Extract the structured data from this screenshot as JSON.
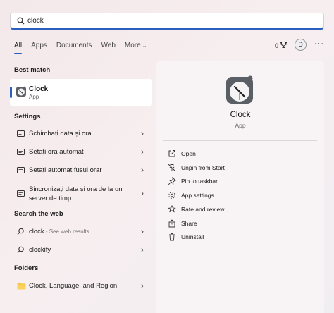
{
  "search": {
    "value": "clock"
  },
  "tabs": [
    {
      "label": "All"
    },
    {
      "label": "Apps"
    },
    {
      "label": "Documents"
    },
    {
      "label": "Web"
    },
    {
      "label": "More"
    }
  ],
  "header": {
    "rewards_count": "0",
    "avatar_initial": "D",
    "more_dots": "···"
  },
  "sections": {
    "best_match": "Best match",
    "settings": "Settings",
    "search_web": "Search the web",
    "folders": "Folders"
  },
  "best_match": {
    "title": "Clock",
    "subtitle": "App"
  },
  "settings_items": [
    {
      "label": "Schimbați data și ora"
    },
    {
      "label": "Setați ora automat"
    },
    {
      "label": "Setați automat fusul orar"
    },
    {
      "label": "Sincronizați data și ora de la un server de timp"
    }
  ],
  "web_items": [
    {
      "label": "clock",
      "sub": " - See web results"
    },
    {
      "label": "clockify",
      "sub": ""
    }
  ],
  "folder_items": [
    {
      "label": "Clock, Language, and Region"
    }
  ],
  "details": {
    "title": "Clock",
    "subtitle": "App",
    "actions": [
      {
        "label": "Open",
        "icon": "open-icon"
      },
      {
        "label": "Unpin from Start",
        "icon": "unpin-icon"
      },
      {
        "label": "Pin to taskbar",
        "icon": "pin-icon"
      },
      {
        "label": "App settings",
        "icon": "gear-icon"
      },
      {
        "label": "Rate and review",
        "icon": "star-icon"
      },
      {
        "label": "Share",
        "icon": "share-icon"
      },
      {
        "label": "Uninstall",
        "icon": "trash-icon"
      }
    ]
  },
  "colors": {
    "accent": "#2a5fbf"
  }
}
